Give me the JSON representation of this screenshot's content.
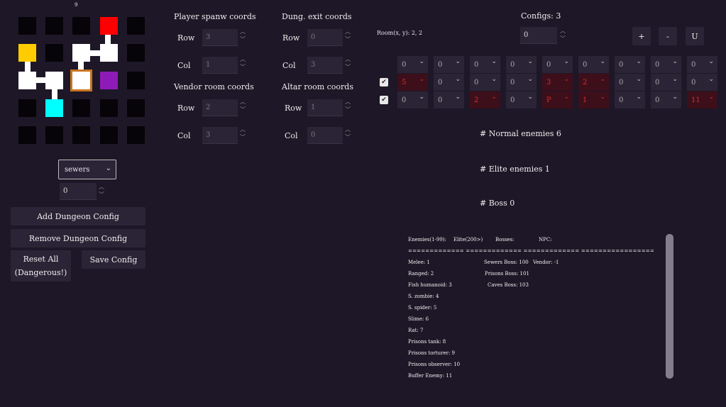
{
  "grid_count": "9",
  "dungeon_map": {
    "rows": [
      [
        "empty",
        "empty",
        "empty",
        "red",
        "empty"
      ],
      [
        "yellow",
        "empty",
        "white",
        "white",
        "empty"
      ],
      [
        "white",
        "white",
        "selected",
        "purple",
        "empty"
      ],
      [
        "empty",
        "cyan",
        "empty",
        "empty",
        "empty"
      ],
      [
        "empty",
        "empty",
        "empty",
        "empty",
        "empty"
      ]
    ],
    "colors": {
      "empty": "#060408",
      "white": "#ffffff",
      "red": "#ff0000",
      "yellow": "#ffcc00",
      "cyan": "#00ffff",
      "purple": "#8e1bb8",
      "selected_border": "#c87520"
    }
  },
  "dungeon_select": {
    "value": "sewers"
  },
  "config_spinner": {
    "value": "0"
  },
  "buttons": {
    "add": "Add Dungeon Config",
    "remove": "Remove Dungeon Config",
    "reset_line1": "Reset All",
    "reset_line2": "(Dangerous!)",
    "save": "Save Config",
    "plus": "+",
    "minus": "-",
    "update": "U"
  },
  "coords": {
    "spawn_title": "Player spanw coords",
    "exit_title": "Dung. exit coords",
    "vendor_title": "Vendor room coords",
    "altar_title": "Altar room coords",
    "row_label": "Row",
    "col_label": "Col",
    "spawn_row": "3",
    "spawn_col": "1",
    "exit_row": "0",
    "exit_col": "3",
    "vendor_row": "2",
    "vendor_col": "3",
    "altar_row": "1",
    "altar_col": "0"
  },
  "configs_label": "Configs: 3",
  "room_label": "Room(x, y): 2, 2",
  "config_index": "0",
  "room_table": {
    "rows": [
      {
        "checkbox": false,
        "cells": [
          "0",
          "0",
          "0",
          "0",
          "0",
          "0",
          "0",
          "0",
          "0"
        ]
      },
      {
        "checkbox": true,
        "cells": [
          "5",
          "0",
          "0",
          "0",
          "3",
          "2",
          "0",
          "0",
          "0"
        ]
      },
      {
        "checkbox": true,
        "cells": [
          "0",
          "0",
          "2",
          "0",
          "P",
          "1",
          "0",
          "0",
          "11"
        ]
      }
    ],
    "first_row_extra": "0",
    "red_cells": [
      [
        1,
        0
      ],
      [
        1,
        4
      ],
      [
        1,
        5
      ],
      [
        2,
        2
      ],
      [
        2,
        4
      ],
      [
        2,
        5
      ],
      [
        2,
        8
      ]
    ]
  },
  "enemy_counts": {
    "normal": "# Normal enemies 6",
    "elite": "# Elite enemies 1",
    "boss": "# Boss 0"
  },
  "legend": {
    "headers": [
      "Enemies(1-99):",
      "Elite(200>)",
      "Bosses:",
      "NPC:"
    ],
    "separator": "=============    =============  =============      =================",
    "enemies": [
      "Melee: 1",
      "Ranged: 2",
      "Fish humanoid: 3",
      "S. zombie: 4",
      "S. spider: 5",
      "Slime: 6",
      "Rat: 7",
      "Prisons tank: 8",
      "Prisons torturer: 9",
      "Prisons observer: 10",
      "Buffer Enemy: 11"
    ],
    "bosses": [
      "Sewers Boss: 100",
      "Prisons Boss: 101",
      "Caves Boss: 103"
    ],
    "npc": [
      "Vendor: -1"
    ]
  }
}
